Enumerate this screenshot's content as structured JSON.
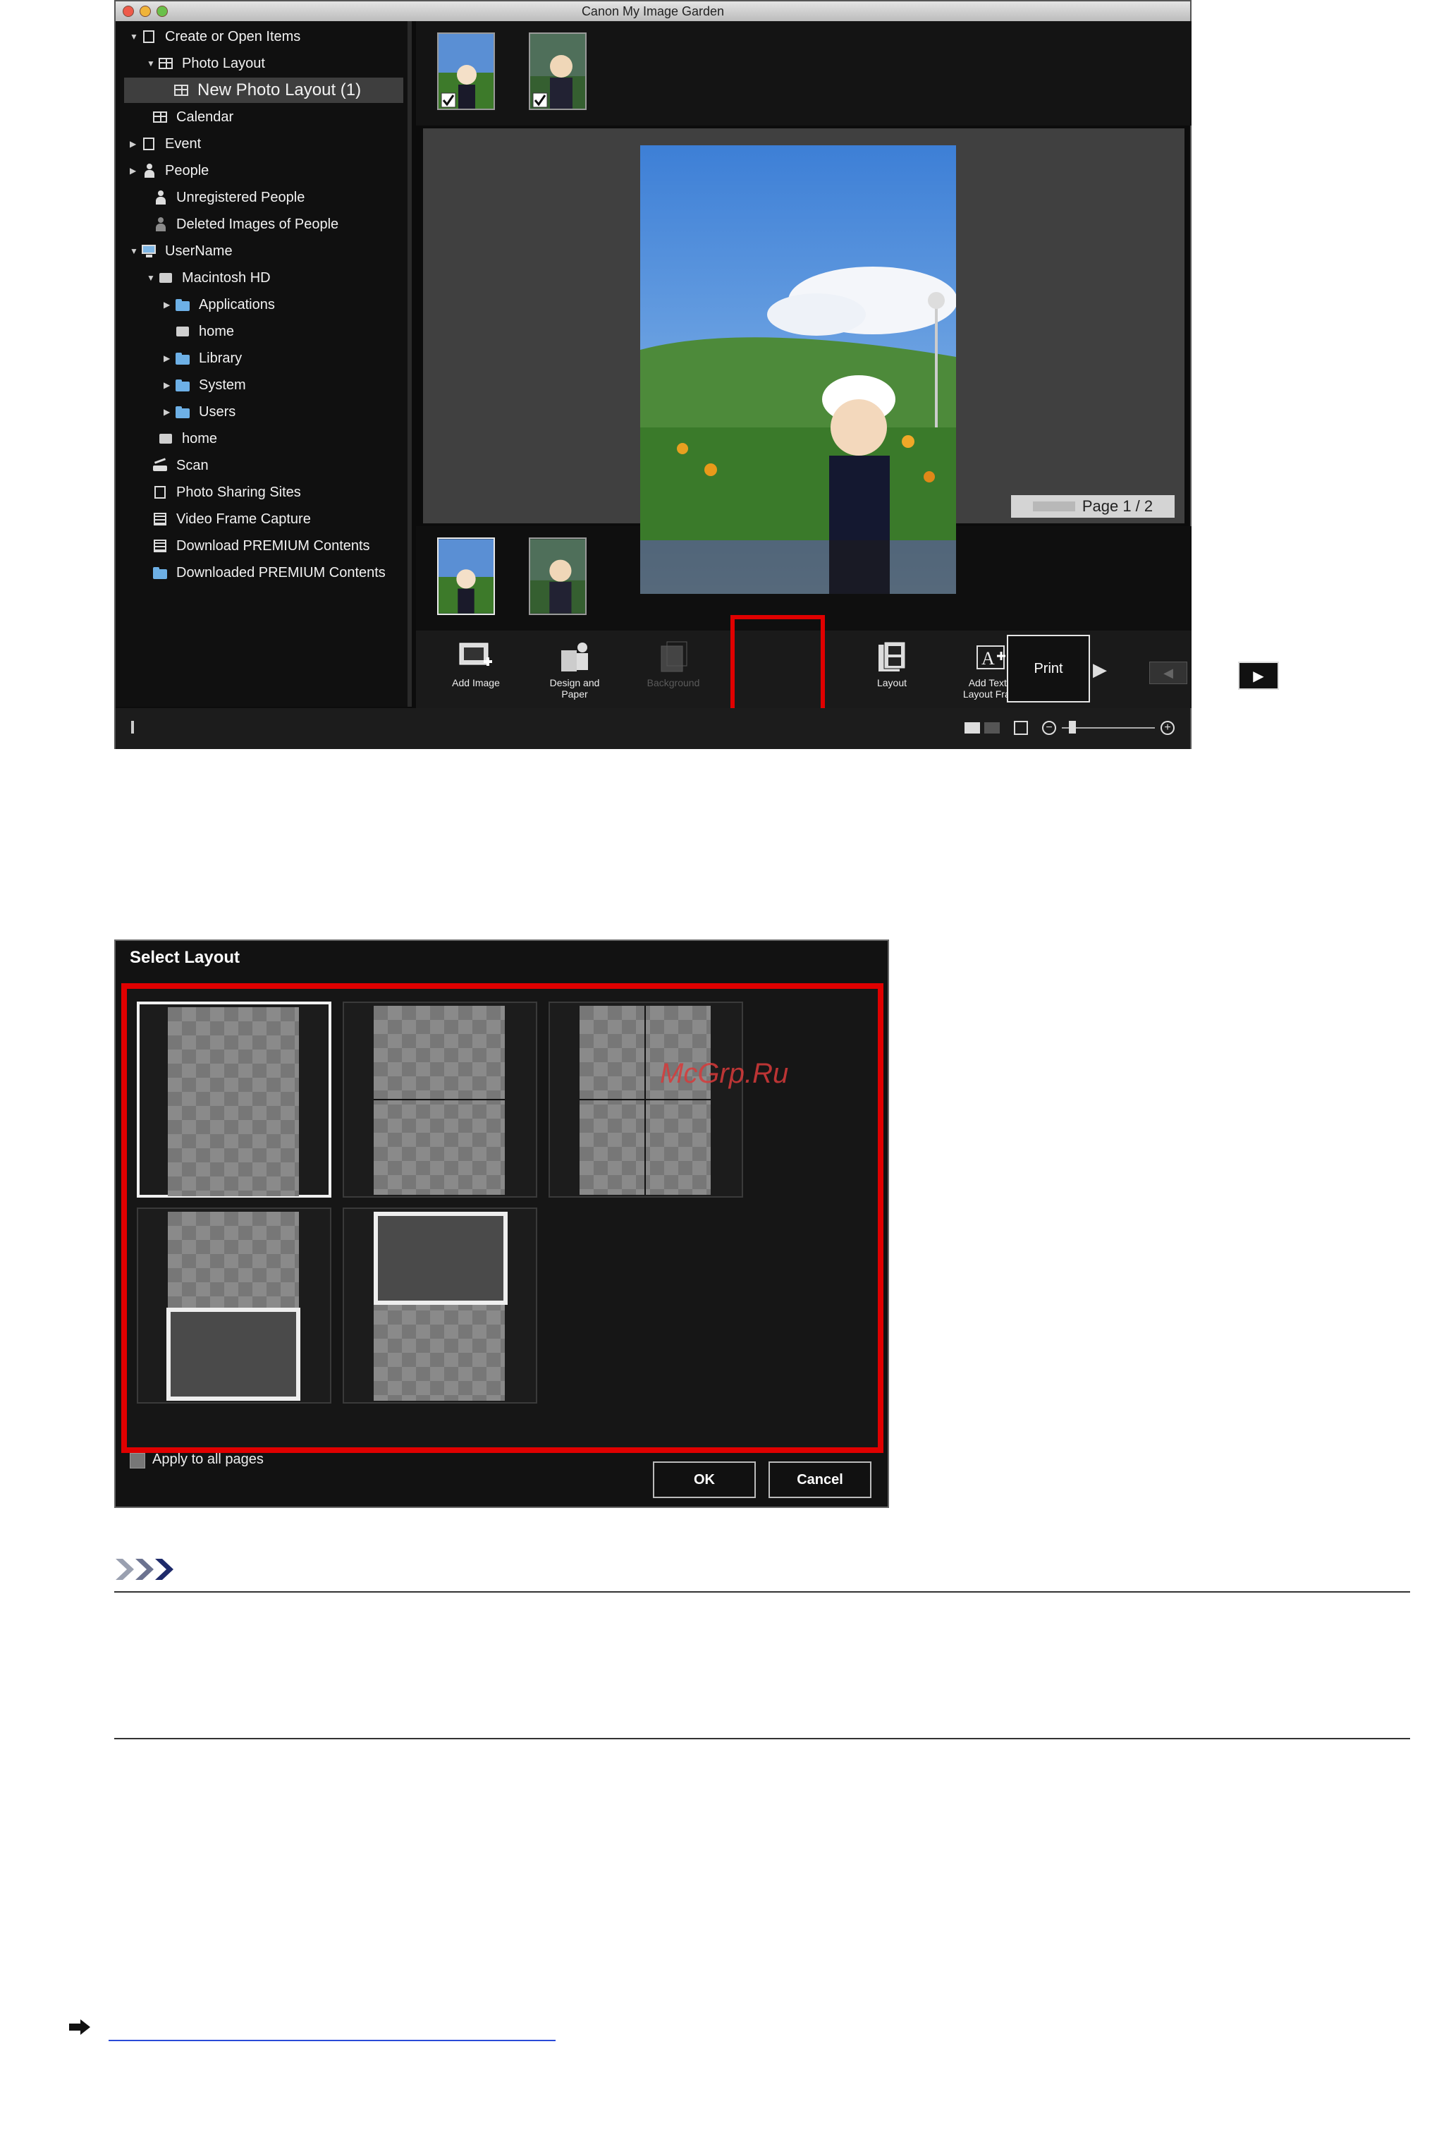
{
  "window": {
    "title": "Canon My Image Garden"
  },
  "sidebar": {
    "items": [
      {
        "label": "Create or Open Items",
        "icon": "create-icon",
        "expander": "▼"
      },
      {
        "label": "Photo Layout",
        "icon": "photo-layout-icon",
        "expander": "▼"
      },
      {
        "label": "New Photo Layout (1)",
        "icon": "layout-grid-icon",
        "expander": ""
      },
      {
        "label": "Calendar",
        "icon": "calendar-icon",
        "expander": ""
      },
      {
        "label": "Event",
        "icon": "event-icon",
        "expander": "▶"
      },
      {
        "label": "People",
        "icon": "person-icon",
        "expander": "▶"
      },
      {
        "label": "Unregistered People",
        "icon": "unregistered-person-icon",
        "expander": ""
      },
      {
        "label": "Deleted Images of People",
        "icon": "deleted-person-icon",
        "expander": ""
      },
      {
        "label": "UserName",
        "icon": "monitor-icon",
        "expander": "▼"
      },
      {
        "label": "Macintosh HD",
        "icon": "drive-icon",
        "expander": "▼"
      },
      {
        "label": "Applications",
        "icon": "folder-icon",
        "expander": "▶"
      },
      {
        "label": "home",
        "icon": "drive-icon",
        "expander": ""
      },
      {
        "label": "Library",
        "icon": "folder-icon",
        "expander": "▶"
      },
      {
        "label": "System",
        "icon": "folder-icon",
        "expander": "▶"
      },
      {
        "label": "Users",
        "icon": "folder-icon",
        "expander": "▶"
      },
      {
        "label": "home",
        "icon": "drive-icon",
        "expander": ""
      },
      {
        "label": "Scan",
        "icon": "scan-icon",
        "expander": ""
      },
      {
        "label": "Photo Sharing Sites",
        "icon": "share-icon",
        "expander": ""
      },
      {
        "label": "Video Frame Capture",
        "icon": "film-icon",
        "expander": ""
      },
      {
        "label": "Download PREMIUM Contents",
        "icon": "download-icon",
        "expander": ""
      },
      {
        "label": "Downloaded PREMIUM Contents",
        "icon": "folder-icon",
        "expander": ""
      }
    ]
  },
  "editor": {
    "page_indicator": "Page 1 / 2"
  },
  "toolbar": {
    "add_image": "Add Image",
    "design_paper_1": "Design and",
    "design_paper_2": "Paper",
    "background": "Background",
    "layout": "Layout",
    "add_text_1": "Add Text or",
    "add_text_2": "Layout Frame",
    "print": "Print"
  },
  "dialog": {
    "title": "Select Layout",
    "apply_all": "Apply to all pages",
    "ok": "OK",
    "cancel": "Cancel"
  },
  "watermark": "McGrp.Ru"
}
